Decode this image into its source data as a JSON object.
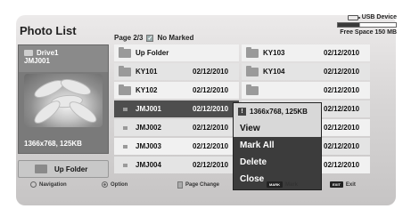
{
  "header": {
    "title": "Photo List",
    "page_info": "Page 2/3",
    "marked": "No Marked"
  },
  "usb": {
    "label": "USB Device",
    "free_space": "Free Space 150 MB",
    "used_fraction": 0.38
  },
  "preview": {
    "drive": "Drive1",
    "folder": "JMJ001",
    "size": "1366x768, 125KB"
  },
  "up_folder_button": "Up Folder",
  "files_left": [
    {
      "name": "Up Folder",
      "date": "",
      "type": "folder"
    },
    {
      "name": "KY101",
      "date": "02/12/2010",
      "type": "folder"
    },
    {
      "name": "KY102",
      "date": "02/12/2010",
      "type": "folder"
    },
    {
      "name": "JMJ001",
      "date": "02/12/2010",
      "type": "photo",
      "selected": true
    },
    {
      "name": "JMJ002",
      "date": "02/12/2010",
      "type": "photo"
    },
    {
      "name": "JMJ003",
      "date": "02/12/2010",
      "type": "photo"
    },
    {
      "name": "JMJ004",
      "date": "02/12/2010",
      "type": "photo"
    }
  ],
  "files_right": [
    {
      "name": "KY103",
      "date": "02/12/2010",
      "type": "folder"
    },
    {
      "name": "KY104",
      "date": "02/12/2010",
      "type": "folder"
    },
    {
      "name": "",
      "date": "02/12/2010",
      "type": "folder"
    },
    {
      "name": "",
      "date": "02/12/2010",
      "type": "photo"
    },
    {
      "name": "",
      "date": "02/12/2010",
      "type": "photo"
    },
    {
      "name": "",
      "date": "02/12/2010",
      "type": "photo"
    },
    {
      "name": "",
      "date": "02/12/2010",
      "type": "photo"
    }
  ],
  "popup": {
    "info": "1366x768, 125KB",
    "items": [
      "View",
      "Mark All",
      "Delete",
      "Close"
    ],
    "active_index": 0
  },
  "footer": {
    "navigation": "Navigation",
    "option": "Option",
    "page_change": "Page Change",
    "mark_key": "MARK",
    "mark": "Mark",
    "exit_key": "EXIT",
    "exit": "Exit"
  }
}
